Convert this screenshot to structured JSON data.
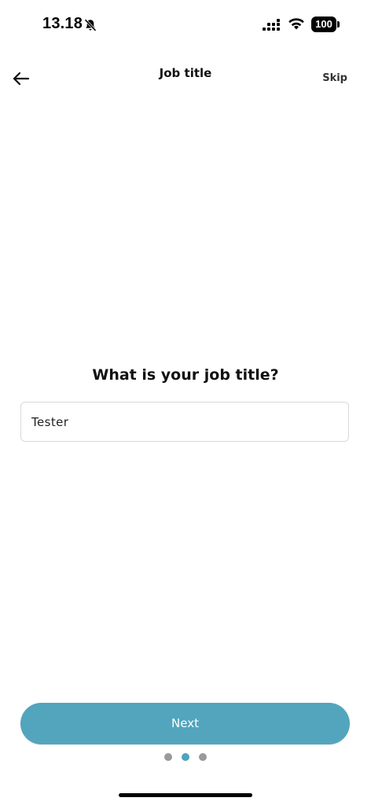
{
  "status_bar": {
    "time": "13.18",
    "battery": "100",
    "icons": [
      "bell-slash-icon",
      "signal-icon",
      "wifi-icon",
      "battery-icon"
    ]
  },
  "header": {
    "title": "Job title",
    "skip_label": "Skip",
    "back_icon": "arrow-left-icon"
  },
  "main": {
    "question": "What is your job title?",
    "job_title_value": "Tester"
  },
  "footer": {
    "next_label": "Next",
    "pagination": {
      "total": 3,
      "current": 2
    }
  },
  "colors": {
    "accent": "#52a5bd",
    "dot_inactive": "#9a9a9a",
    "input_border": "#d9d9d9"
  }
}
